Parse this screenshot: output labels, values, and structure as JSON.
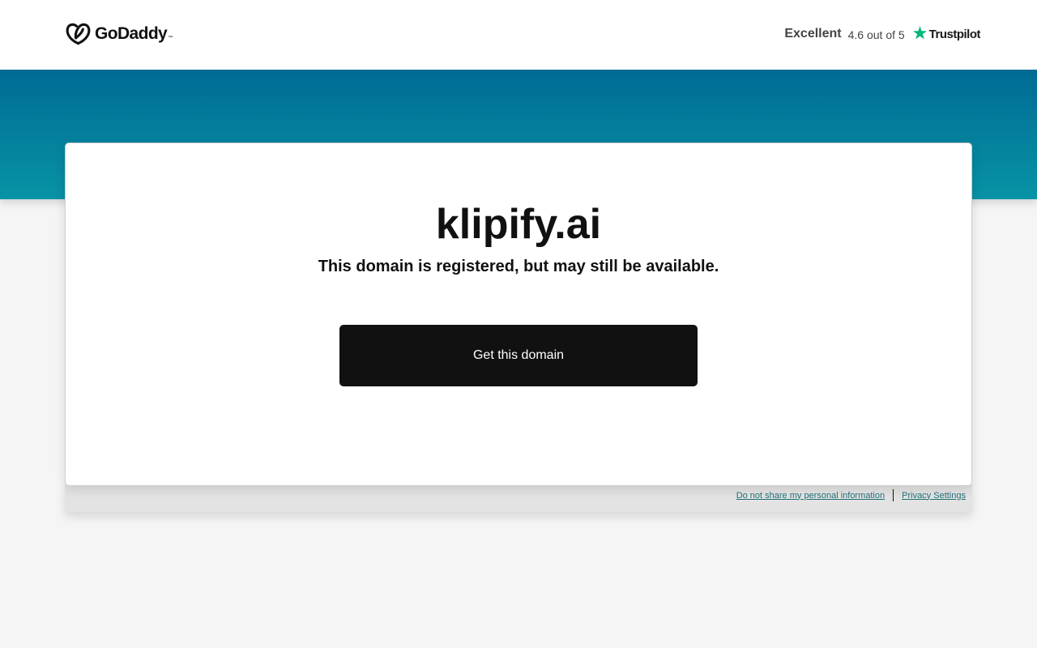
{
  "header": {
    "logo_text": "GoDaddy",
    "logo_tm": "™",
    "logo_icon": "godaddy-heart-icon",
    "rating": {
      "label": "Excellent",
      "score_text": "4.6 out of 5",
      "trustpilot_text": "Trustpilot",
      "trustpilot_icon": "trustpilot-star-icon",
      "star_color": "#00b67a"
    }
  },
  "hero": {
    "gradient_top": "#006b94",
    "gradient_bottom": "#0893a6"
  },
  "card": {
    "domain": "klipify.ai",
    "subtitle": "This domain is registered, but may still be available.",
    "cta_label": "Get this domain"
  },
  "footer": {
    "links": [
      {
        "label": "Do not share my personal information"
      },
      {
        "label": "Privacy Settings"
      }
    ],
    "link_color": "#1f6f76"
  }
}
